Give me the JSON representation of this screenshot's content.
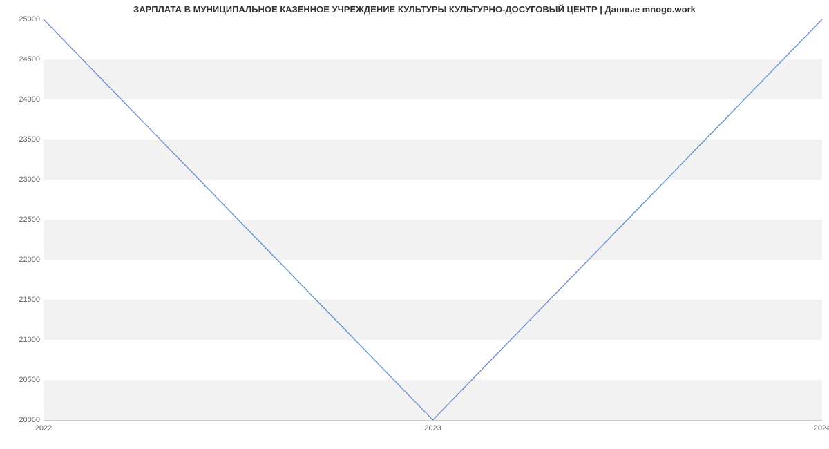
{
  "chart_data": {
    "type": "line",
    "title": "ЗАРПЛАТА В МУНИЦИПАЛЬНОЕ КАЗЕННОЕ УЧРЕЖДЕНИЕ КУЛЬТУРЫ КУЛЬТУРНО-ДОСУГОВЫЙ ЦЕНТР | Данные mnogo.work",
    "xlabel": "",
    "ylabel": "",
    "x_ticks": [
      "2022",
      "2023",
      "2024"
    ],
    "y_ticks": [
      20000,
      20500,
      21000,
      21500,
      22000,
      22500,
      23000,
      23500,
      24000,
      24500,
      25000
    ],
    "ylim": [
      20000,
      25000
    ],
    "x": [
      "2022",
      "2023",
      "2024"
    ],
    "values": [
      25000,
      20000,
      25000
    ],
    "line_color": "#6b8fd4",
    "band_color": "#f2f2f2"
  }
}
